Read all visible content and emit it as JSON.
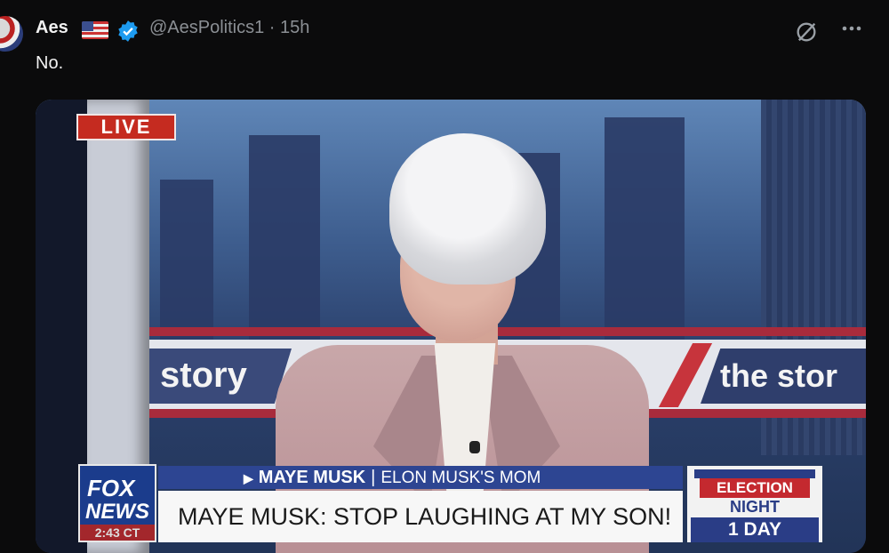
{
  "tweet": {
    "author_name": "Aes",
    "handle_time": "@AesPolitics1 · 15h",
    "text": "No.",
    "icons": [
      "flag-us-icon",
      "verified-badge-icon",
      "grok-icon",
      "more-icon"
    ]
  },
  "broadcast": {
    "live_label": "LIVE",
    "backdrop_left": "story",
    "backdrop_right": "the stor",
    "network_line1": "FOX",
    "network_line2": "NEWS",
    "time": "2:43 CT",
    "chyron_name": "MAYE MUSK",
    "chyron_role": "ELON MUSK'S MOM",
    "headline": "MAYE MUSK: STOP LAUGHING AT MY SON!",
    "election_line1": "ELECTION",
    "election_line2": "NIGHT",
    "election_countdown": "1 DAY"
  },
  "colors": {
    "background": "#0b0b0c",
    "live_red": "#c52b20",
    "fox_blue": "#1b3c8c",
    "verified_blue": "#1d9bf0"
  }
}
